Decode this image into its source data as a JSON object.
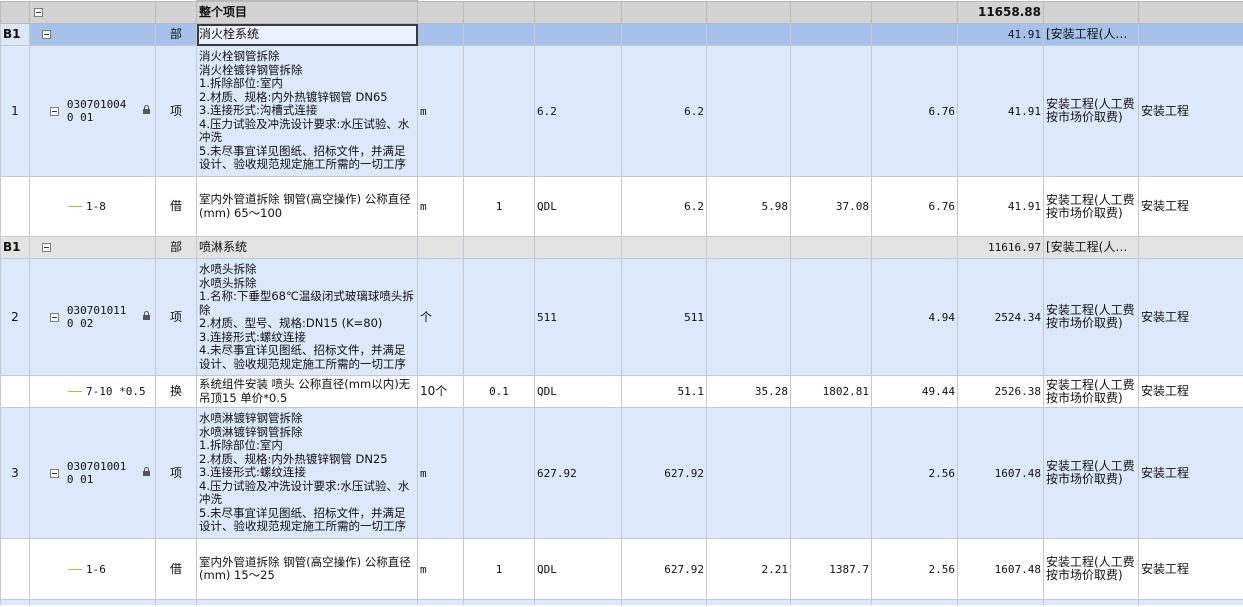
{
  "project": {
    "name": "整个项目",
    "total": "11658.88"
  },
  "sections": [
    {
      "id": "B1",
      "kind": "部",
      "name": "消火栓系统",
      "total": "41.91",
      "category": "[安装工程(人…"
    },
    {
      "id": "B1",
      "kind": "部",
      "name": "喷淋系统",
      "total": "11616.97",
      "category": "[安装工程(人…"
    }
  ],
  "items": [
    {
      "seq": "1",
      "code": "0307010040 01",
      "kind": "项",
      "desc": [
        "消火栓钢管拆除",
        "消火栓镀锌钢管拆除",
        "1.拆除部位:室内",
        "2.材质、规格:内外热镀锌钢管 DN65",
        "3.连接形式:沟槽式连接",
        "4.压力试验及冲洗设计要求:水压试验、水冲洗",
        "5.未尽事宜详见图纸、招标文件，并满足设计、验收规范规定施工所需的一切工序"
      ],
      "unit": "m",
      "expr": "",
      "qty_expr": "6.2",
      "qty": "6.2",
      "c1": "",
      "c2": "",
      "price": "6.76",
      "amount": "41.91",
      "cat": "安装工程(人工费按市场价取费)",
      "prof": "安装工程"
    },
    {
      "seq": "",
      "code": "1-8",
      "kind": "借",
      "desc": [
        "室内外管道拆除 钢管(高空操作) 公称直径(mm) 65～100"
      ],
      "unit": "m",
      "expr": "1",
      "qty_expr": "QDL",
      "qty": "6.2",
      "c1": "5.98",
      "c2": "37.08",
      "price": "6.76",
      "amount": "41.91",
      "cat": "安装工程(人工费按市场价取费)",
      "prof": "安装工程"
    },
    {
      "seq": "2",
      "code": "0307010110 02",
      "kind": "项",
      "desc": [
        "水喷头拆除",
        "水喷头拆除",
        "1.名称:下垂型68℃温级闭式玻璃球喷头拆除",
        "2.材质、型号、规格:DN15 (K=80)",
        "3.连接形式:螺纹连接",
        "4.未尽事宜详见图纸、招标文件，并满足设计、验收规范规定施工所需的一切工序"
      ],
      "unit": "个",
      "expr": "",
      "qty_expr": "511",
      "qty": "511",
      "c1": "",
      "c2": "",
      "price": "4.94",
      "amount": "2524.34",
      "cat": "安装工程(人工费按市场价取费)",
      "prof": "安装工程"
    },
    {
      "seq": "",
      "code": "7-10 *0.5",
      "kind": "换",
      "desc": [
        "系统组件安装 喷头 公称直径(mm以内)无吊顶15  单价*0.5"
      ],
      "unit": "10个",
      "expr": "0.1",
      "qty_expr": "QDL",
      "qty": "51.1",
      "c1": "35.28",
      "c2": "1802.81",
      "price": "49.44",
      "amount": "2526.38",
      "cat": "安装工程(人工费按市场价取费)",
      "prof": "安装工程"
    },
    {
      "seq": "3",
      "code": "0307010010 01",
      "kind": "项",
      "desc": [
        "水喷淋镀锌钢管拆除",
        "水喷淋镀锌钢管拆除",
        "1.拆除部位:室内",
        "2.材质、规格:内外热镀锌钢管 DN25",
        "3.连接形式:螺纹连接",
        "4.压力试验及冲洗设计要求:水压试验、水冲洗",
        "5.未尽事宜详见图纸、招标文件，并满足设计、验收规范规定施工所需的一切工序"
      ],
      "unit": "m",
      "expr": "",
      "qty_expr": "627.92",
      "qty": "627.92",
      "c1": "",
      "c2": "",
      "price": "2.56",
      "amount": "1607.48",
      "cat": "安装工程(人工费按市场价取费)",
      "prof": "安装工程"
    },
    {
      "seq": "",
      "code": "1-6",
      "kind": "借",
      "desc": [
        "室内外管道拆除 钢管(高空操作) 公称直径(mm) 15～25"
      ],
      "unit": "m",
      "expr": "1",
      "qty_expr": "QDL",
      "qty": "627.92",
      "c1": "2.21",
      "c2": "1387.7",
      "price": "2.56",
      "amount": "1607.48",
      "cat": "安装工程(人工费按市场价取费)",
      "prof": "安装工程"
    }
  ]
}
